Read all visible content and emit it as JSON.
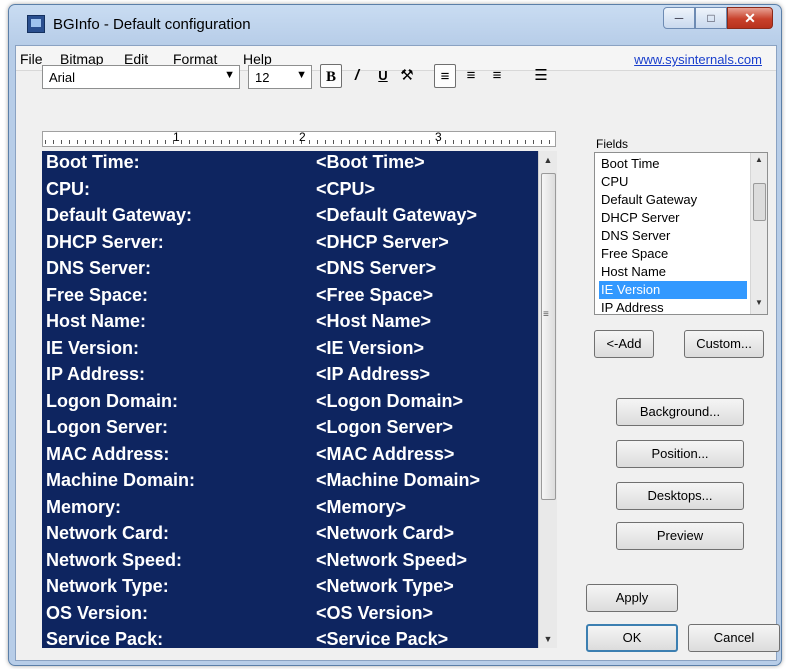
{
  "window": {
    "title": "BGInfo - Default configuration"
  },
  "menu": {
    "items": [
      "File",
      "Bitmap",
      "Edit",
      "Format",
      "Help"
    ],
    "link": "www.sysinternals.com"
  },
  "toolbar": {
    "font_name": "Arial",
    "font_size": "12",
    "bold_label": "B",
    "italic_label": "/",
    "underline_label": "U",
    "icons": [
      "bold-icon",
      "italic-icon",
      "underline-icon",
      "color-icon",
      "align-left-icon",
      "align-center-icon",
      "align-right-icon",
      "bullets-icon"
    ]
  },
  "ruler": {
    "marks": [
      "1",
      "2",
      "3"
    ]
  },
  "editor": {
    "background_color": "#0e2560",
    "rows": [
      {
        "label": "Boot Time:",
        "value": "<Boot Time>"
      },
      {
        "label": "CPU:",
        "value": "<CPU>"
      },
      {
        "label": "Default Gateway:",
        "value": "<Default Gateway>"
      },
      {
        "label": "DHCP Server:",
        "value": "<DHCP Server>"
      },
      {
        "label": "DNS Server:",
        "value": "<DNS Server>"
      },
      {
        "label": "Free Space:",
        "value": "<Free Space>"
      },
      {
        "label": "Host Name:",
        "value": "<Host Name>"
      },
      {
        "label": "IE Version:",
        "value": "<IE Version>"
      },
      {
        "label": "IP Address:",
        "value": "<IP Address>"
      },
      {
        "label": "Logon Domain:",
        "value": "<Logon Domain>"
      },
      {
        "label": "Logon Server:",
        "value": "<Logon Server>"
      },
      {
        "label": "MAC Address:",
        "value": "<MAC Address>"
      },
      {
        "label": "Machine Domain:",
        "value": "<Machine Domain>"
      },
      {
        "label": "Memory:",
        "value": "<Memory>"
      },
      {
        "label": "Network Card:",
        "value": "<Network Card>"
      },
      {
        "label": "Network Speed:",
        "value": "<Network Speed>"
      },
      {
        "label": "Network Type:",
        "value": "<Network Type>"
      },
      {
        "label": "OS Version:",
        "value": "<OS Version>"
      },
      {
        "label": "Service Pack:",
        "value": "<Service Pack>"
      }
    ]
  },
  "fields": {
    "label": "Fields",
    "items": [
      "Boot Time",
      "CPU",
      "Default Gateway",
      "DHCP Server",
      "DNS Server",
      "Free Space",
      "Host Name",
      "IE Version",
      "IP Address"
    ],
    "selected": "IE Version",
    "selected_color": "#3399ff"
  },
  "buttons": {
    "add": "<-Add",
    "custom": "Custom...",
    "background": "Background...",
    "position": "Position...",
    "desktops": "Desktops...",
    "preview": "Preview",
    "apply": "Apply",
    "ok": "OK",
    "cancel": "Cancel"
  }
}
